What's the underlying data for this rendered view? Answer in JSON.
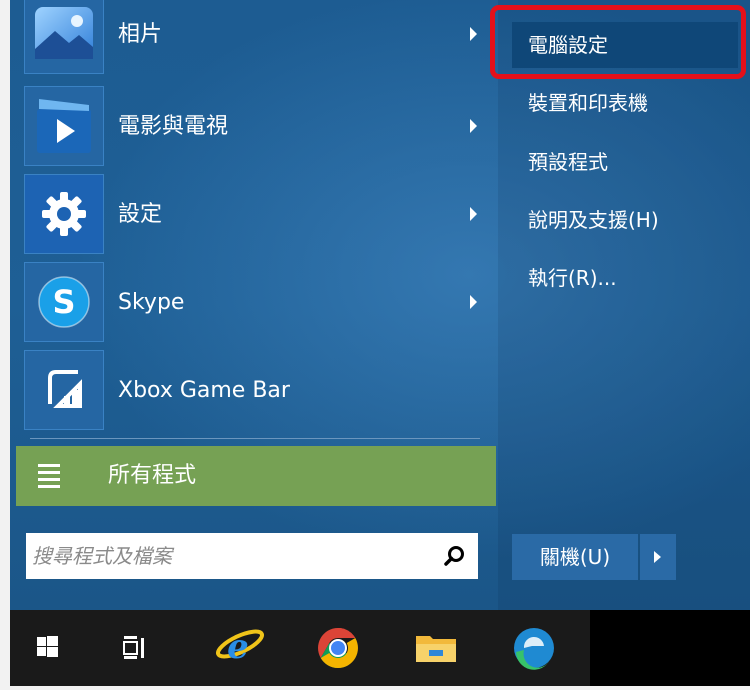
{
  "apps": [
    {
      "label": "相片",
      "icon": "photos-icon",
      "has_submenu": true
    },
    {
      "label": "電影與電視",
      "icon": "movies-tv-icon",
      "has_submenu": true
    },
    {
      "label": "設定",
      "icon": "settings-gear-icon",
      "has_submenu": true
    },
    {
      "label": "Skype",
      "icon": "skype-icon",
      "has_submenu": true
    },
    {
      "label": "Xbox Game Bar",
      "icon": "xbox-game-bar-icon",
      "has_submenu": false
    }
  ],
  "all_programs": {
    "label": "所有程式",
    "icon": "list-icon",
    "color": "#76a154"
  },
  "search": {
    "placeholder": "搜尋程式及檔案",
    "icon": "search-icon"
  },
  "right_menu": [
    {
      "label": "電腦設定",
      "highlighted": true
    },
    {
      "label": "裝置和印表機"
    },
    {
      "label": "預設程式"
    },
    {
      "label": "說明及支援(H)"
    },
    {
      "label": "執行(R)..."
    }
  ],
  "shutdown": {
    "label": "關機(U)"
  },
  "highlight_color": "#e4101a",
  "taskbar": [
    {
      "icon": "windows-start-icon"
    },
    {
      "icon": "task-view-icon"
    },
    {
      "icon": "internet-explorer-icon"
    },
    {
      "icon": "chrome-icon"
    },
    {
      "icon": "file-explorer-icon"
    },
    {
      "icon": "edge-icon"
    }
  ]
}
